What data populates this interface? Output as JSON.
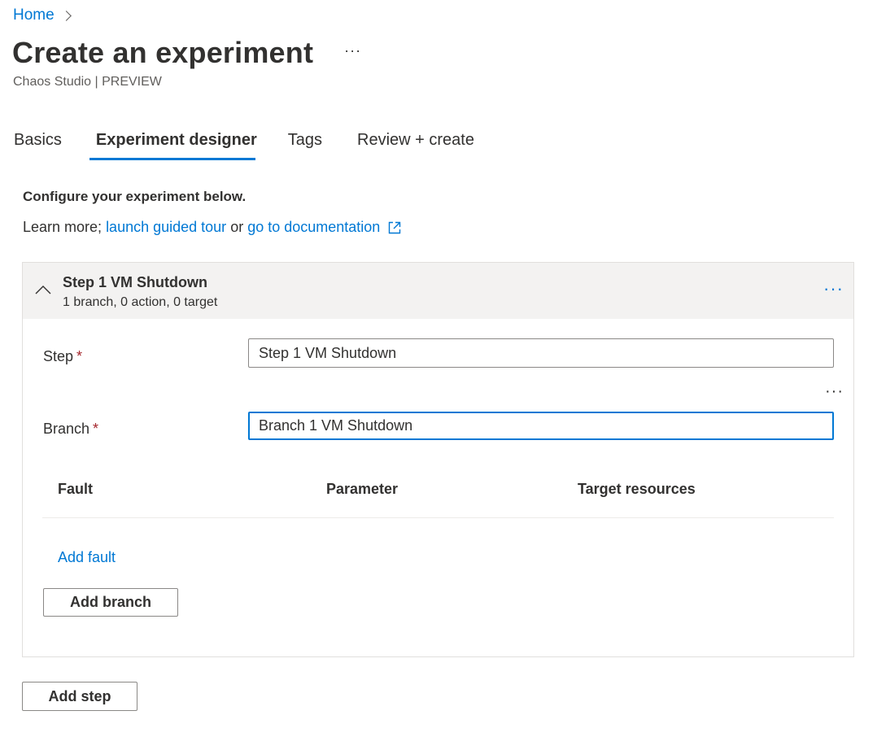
{
  "breadcrumb": {
    "home": "Home"
  },
  "header": {
    "title": "Create an experiment",
    "more": "···",
    "subtitle": "Chaos Studio | PREVIEW"
  },
  "tabs": [
    {
      "label": "Basics"
    },
    {
      "label": "Experiment designer",
      "active": true
    },
    {
      "label": "Tags"
    },
    {
      "label": "Review + create"
    }
  ],
  "intro": {
    "heading": "Configure your experiment below.",
    "prefix": "Learn more; ",
    "link1": "launch guided tour",
    "middle": " or ",
    "link2": "go to documentation"
  },
  "step": {
    "name": "Step 1 VM Shutdown",
    "meta": "1 branch, 0 action, 0 target",
    "more": "···",
    "step_label": "Step",
    "step_value": "Step 1 VM Shutdown",
    "branch_more": "···",
    "branch_label": "Branch",
    "branch_value": "Branch 1 VM Shutdown",
    "required": "*",
    "columns": [
      "Fault",
      "Parameter",
      "Target resources"
    ],
    "add_fault": "Add fault",
    "add_branch": "Add branch"
  },
  "add_step": "Add step",
  "colors": {
    "accent": "#0078d4",
    "required": "#a4262c",
    "header_bg": "#f3f2f1"
  }
}
